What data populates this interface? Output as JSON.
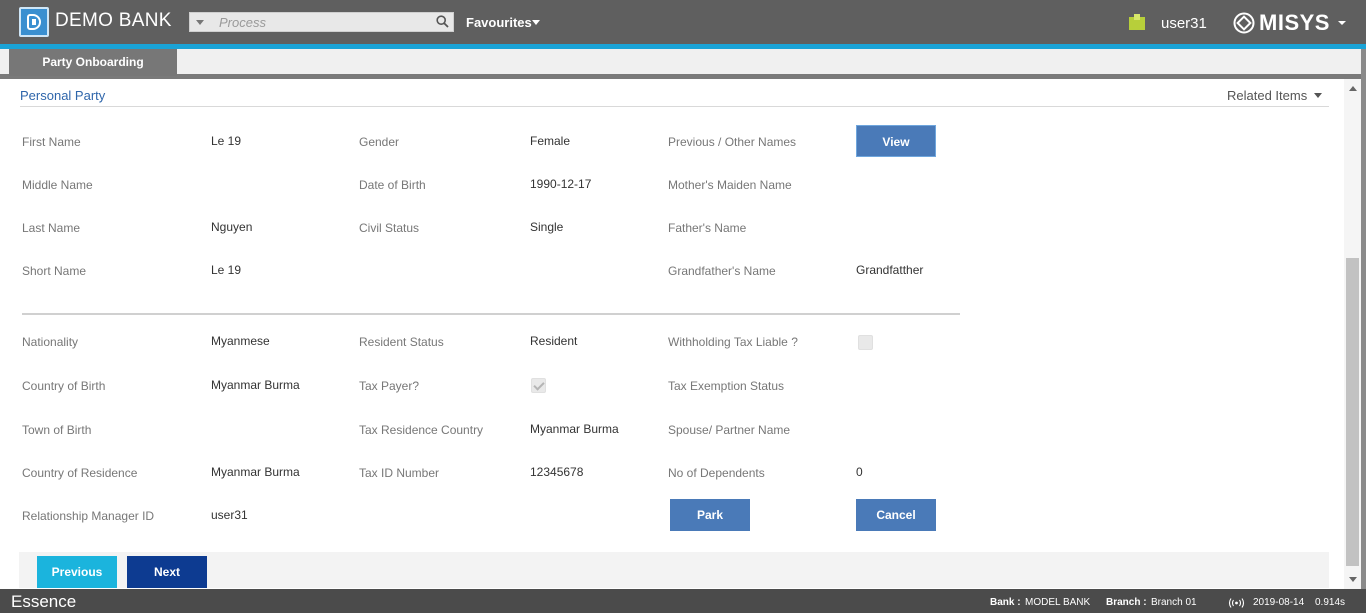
{
  "header": {
    "brand": "DEMO BANK",
    "search_placeholder": "Process",
    "favourites": "Favourites",
    "user": "user31",
    "vendor": "MISYS"
  },
  "tabs": [
    {
      "label": "Party Onboarding",
      "active": true
    }
  ],
  "section": {
    "title": "Personal Party",
    "related_items": "Related Items"
  },
  "fields": {
    "first_name": {
      "label": "First Name",
      "value": "Le 19"
    },
    "middle_name": {
      "label": "Middle Name",
      "value": ""
    },
    "last_name": {
      "label": "Last Name",
      "value": "Nguyen"
    },
    "short_name": {
      "label": "Short Name",
      "value": "Le 19"
    },
    "gender": {
      "label": "Gender",
      "value": "Female"
    },
    "date_of_birth": {
      "label": "Date of Birth",
      "value": "1990-12-17"
    },
    "civil_status": {
      "label": "Civil Status",
      "value": "Single"
    },
    "previous_names": {
      "label": "Previous / Other Names"
    },
    "mothers_maiden_name": {
      "label": "Mother's Maiden Name",
      "value": ""
    },
    "fathers_name": {
      "label": "Father's Name",
      "value": ""
    },
    "grandfathers_name": {
      "label": "Grandfather's Name",
      "value": "Grandfatther"
    },
    "nationality": {
      "label": "Nationality",
      "value": "Myanmese"
    },
    "country_of_birth": {
      "label": "Country of Birth",
      "value": "Myanmar Burma"
    },
    "town_of_birth": {
      "label": "Town of Birth",
      "value": ""
    },
    "country_of_residence": {
      "label": "Country of Residence",
      "value": "Myanmar Burma"
    },
    "relationship_manager_id": {
      "label": "Relationship Manager ID",
      "value": "user31"
    },
    "resident_status": {
      "label": "Resident Status",
      "value": "Resident"
    },
    "tax_payer": {
      "label": "Tax Payer?",
      "checked": true
    },
    "tax_residence_country": {
      "label": "Tax Residence Country",
      "value": "Myanmar Burma"
    },
    "tax_id_number": {
      "label": "Tax ID Number",
      "value": "12345678"
    },
    "withholding_tax_liable": {
      "label": "Withholding Tax Liable ?",
      "checked": false
    },
    "tax_exemption_status": {
      "label": "Tax Exemption Status",
      "value": ""
    },
    "spouse_partner_name": {
      "label": "Spouse/ Partner Name",
      "value": ""
    },
    "no_of_dependents": {
      "label": "No of Dependents",
      "value": "0"
    }
  },
  "buttons": {
    "view": "View",
    "park": "Park",
    "cancel": "Cancel",
    "previous": "Previous",
    "next": "Next"
  },
  "statusbar": {
    "product": "Essence",
    "bank_label": "Bank :",
    "bank_value": "MODEL BANK",
    "branch_label": "Branch :",
    "branch_value": "Branch 01",
    "date": "2019-08-14",
    "timing": "0.914s"
  },
  "colors": {
    "topbar": "#5f5f5f",
    "accent": "#1aa3d6",
    "primary_button": "#4a7ab8",
    "previous_button": "#1bb4dd",
    "next_button": "#0d3b91",
    "section_title": "#2f66ab"
  },
  "icons": [
    "logo-icon",
    "search-icon",
    "user-icon",
    "misys-logo-icon",
    "signal-icon"
  ]
}
